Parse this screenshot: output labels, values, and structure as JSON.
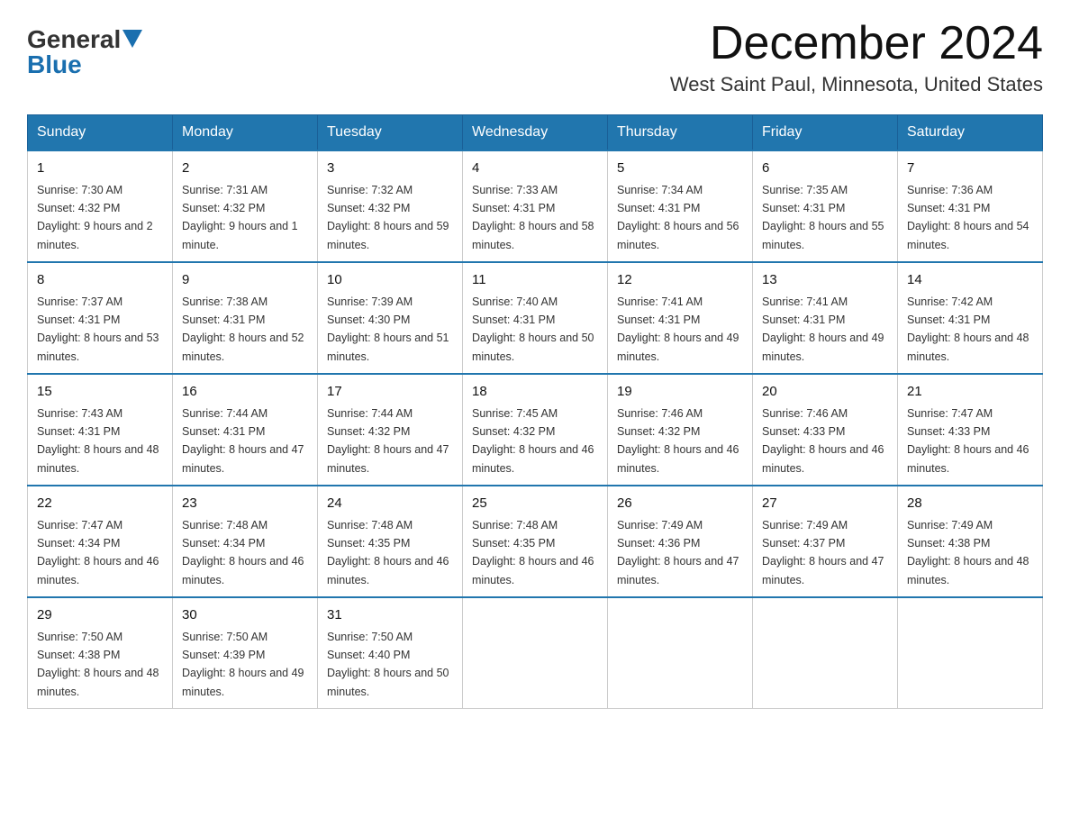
{
  "header": {
    "logo_general": "General",
    "logo_blue": "Blue",
    "month_title": "December 2024",
    "location": "West Saint Paul, Minnesota, United States"
  },
  "weekdays": [
    "Sunday",
    "Monday",
    "Tuesday",
    "Wednesday",
    "Thursday",
    "Friday",
    "Saturday"
  ],
  "weeks": [
    [
      {
        "day": "1",
        "sunrise": "7:30 AM",
        "sunset": "4:32 PM",
        "daylight": "9 hours and 2 minutes."
      },
      {
        "day": "2",
        "sunrise": "7:31 AM",
        "sunset": "4:32 PM",
        "daylight": "9 hours and 1 minute."
      },
      {
        "day": "3",
        "sunrise": "7:32 AM",
        "sunset": "4:32 PM",
        "daylight": "8 hours and 59 minutes."
      },
      {
        "day": "4",
        "sunrise": "7:33 AM",
        "sunset": "4:31 PM",
        "daylight": "8 hours and 58 minutes."
      },
      {
        "day": "5",
        "sunrise": "7:34 AM",
        "sunset": "4:31 PM",
        "daylight": "8 hours and 56 minutes."
      },
      {
        "day": "6",
        "sunrise": "7:35 AM",
        "sunset": "4:31 PM",
        "daylight": "8 hours and 55 minutes."
      },
      {
        "day": "7",
        "sunrise": "7:36 AM",
        "sunset": "4:31 PM",
        "daylight": "8 hours and 54 minutes."
      }
    ],
    [
      {
        "day": "8",
        "sunrise": "7:37 AM",
        "sunset": "4:31 PM",
        "daylight": "8 hours and 53 minutes."
      },
      {
        "day": "9",
        "sunrise": "7:38 AM",
        "sunset": "4:31 PM",
        "daylight": "8 hours and 52 minutes."
      },
      {
        "day": "10",
        "sunrise": "7:39 AM",
        "sunset": "4:30 PM",
        "daylight": "8 hours and 51 minutes."
      },
      {
        "day": "11",
        "sunrise": "7:40 AM",
        "sunset": "4:31 PM",
        "daylight": "8 hours and 50 minutes."
      },
      {
        "day": "12",
        "sunrise": "7:41 AM",
        "sunset": "4:31 PM",
        "daylight": "8 hours and 49 minutes."
      },
      {
        "day": "13",
        "sunrise": "7:41 AM",
        "sunset": "4:31 PM",
        "daylight": "8 hours and 49 minutes."
      },
      {
        "day": "14",
        "sunrise": "7:42 AM",
        "sunset": "4:31 PM",
        "daylight": "8 hours and 48 minutes."
      }
    ],
    [
      {
        "day": "15",
        "sunrise": "7:43 AM",
        "sunset": "4:31 PM",
        "daylight": "8 hours and 48 minutes."
      },
      {
        "day": "16",
        "sunrise": "7:44 AM",
        "sunset": "4:31 PM",
        "daylight": "8 hours and 47 minutes."
      },
      {
        "day": "17",
        "sunrise": "7:44 AM",
        "sunset": "4:32 PM",
        "daylight": "8 hours and 47 minutes."
      },
      {
        "day": "18",
        "sunrise": "7:45 AM",
        "sunset": "4:32 PM",
        "daylight": "8 hours and 46 minutes."
      },
      {
        "day": "19",
        "sunrise": "7:46 AM",
        "sunset": "4:32 PM",
        "daylight": "8 hours and 46 minutes."
      },
      {
        "day": "20",
        "sunrise": "7:46 AM",
        "sunset": "4:33 PM",
        "daylight": "8 hours and 46 minutes."
      },
      {
        "day": "21",
        "sunrise": "7:47 AM",
        "sunset": "4:33 PM",
        "daylight": "8 hours and 46 minutes."
      }
    ],
    [
      {
        "day": "22",
        "sunrise": "7:47 AM",
        "sunset": "4:34 PM",
        "daylight": "8 hours and 46 minutes."
      },
      {
        "day": "23",
        "sunrise": "7:48 AM",
        "sunset": "4:34 PM",
        "daylight": "8 hours and 46 minutes."
      },
      {
        "day": "24",
        "sunrise": "7:48 AM",
        "sunset": "4:35 PM",
        "daylight": "8 hours and 46 minutes."
      },
      {
        "day": "25",
        "sunrise": "7:48 AM",
        "sunset": "4:35 PM",
        "daylight": "8 hours and 46 minutes."
      },
      {
        "day": "26",
        "sunrise": "7:49 AM",
        "sunset": "4:36 PM",
        "daylight": "8 hours and 47 minutes."
      },
      {
        "day": "27",
        "sunrise": "7:49 AM",
        "sunset": "4:37 PM",
        "daylight": "8 hours and 47 minutes."
      },
      {
        "day": "28",
        "sunrise": "7:49 AM",
        "sunset": "4:38 PM",
        "daylight": "8 hours and 48 minutes."
      }
    ],
    [
      {
        "day": "29",
        "sunrise": "7:50 AM",
        "sunset": "4:38 PM",
        "daylight": "8 hours and 48 minutes."
      },
      {
        "day": "30",
        "sunrise": "7:50 AM",
        "sunset": "4:39 PM",
        "daylight": "8 hours and 49 minutes."
      },
      {
        "day": "31",
        "sunrise": "7:50 AM",
        "sunset": "4:40 PM",
        "daylight": "8 hours and 50 minutes."
      },
      null,
      null,
      null,
      null
    ]
  ]
}
